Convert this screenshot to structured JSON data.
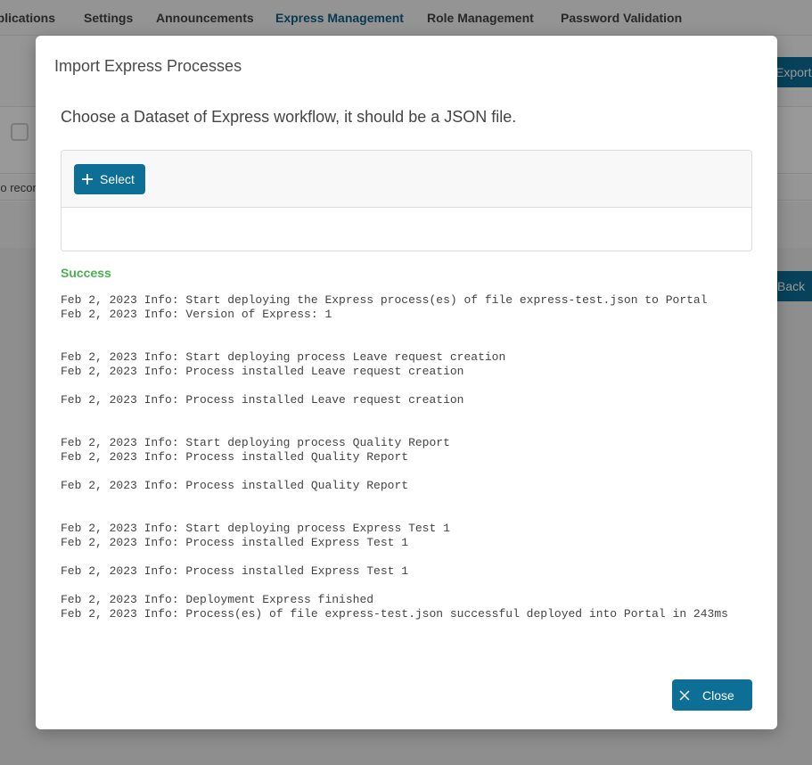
{
  "background": {
    "tabs": [
      {
        "label": "Applications"
      },
      {
        "label": "Settings"
      },
      {
        "label": "Announcements"
      },
      {
        "label": "Express Management"
      },
      {
        "label": "Role Management"
      },
      {
        "label": "Password Validation"
      }
    ],
    "export_button_label": "Export",
    "no_records_text": "No records found",
    "back_button_label": "Back"
  },
  "dialog": {
    "title": "Import Express Processes",
    "subtitle": "Choose a Dataset of Express workflow, it should be a JSON file.",
    "select_button_label": "Select",
    "status_text": "Success",
    "log_lines": [
      "Feb 2, 2023 Info: Start deploying the Express process(es) of file express-test.json to Portal",
      "Feb 2, 2023 Info: Version of Express: 1",
      "",
      "",
      "Feb 2, 2023 Info: Start deploying process Leave request creation",
      "Feb 2, 2023 Info: Process installed Leave request creation",
      "",
      "Feb 2, 2023 Info: Process installed Leave request creation",
      "",
      "",
      "Feb 2, 2023 Info: Start deploying process Quality Report",
      "Feb 2, 2023 Info: Process installed Quality Report",
      "",
      "Feb 2, 2023 Info: Process installed Quality Report",
      "",
      "",
      "Feb 2, 2023 Info: Start deploying process Express Test 1",
      "Feb 2, 2023 Info: Process installed Express Test 1",
      "",
      "Feb 2, 2023 Info: Process installed Express Test 1",
      "",
      "Feb 2, 2023 Info: Deployment Express finished",
      "Feb 2, 2023 Info: Process(es) of file express-test.json successful deployed into Portal in 243ms"
    ],
    "close_button_label": "Close"
  },
  "icons": {
    "select": "plus-icon",
    "close": "close-icon"
  },
  "colors": {
    "primary": "#0d6e96",
    "success": "#4caf50",
    "active_tab": "#0d5f86"
  }
}
